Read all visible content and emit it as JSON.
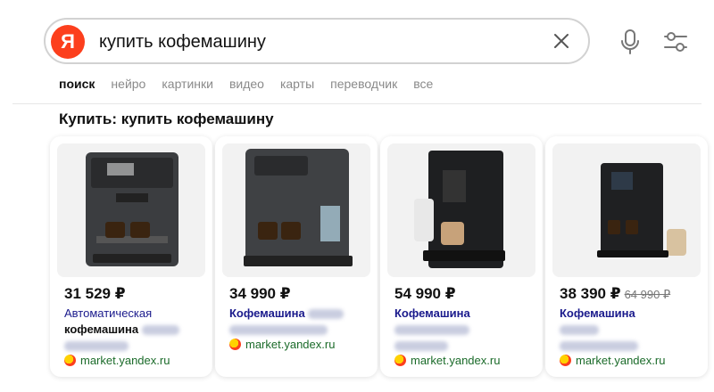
{
  "search": {
    "logo": "Я",
    "query": "купить кофемашину"
  },
  "tabs": [
    {
      "label": "поиск",
      "active": true
    },
    {
      "label": "нейро",
      "active": false
    },
    {
      "label": "картинки",
      "active": false
    },
    {
      "label": "видео",
      "active": false
    },
    {
      "label": "карты",
      "active": false
    },
    {
      "label": "переводчик",
      "active": false
    },
    {
      "label": "все",
      "active": false
    }
  ],
  "section_title": "Купить: купить кофемашину",
  "products": [
    {
      "price": "31 529 ₽",
      "old_price": "",
      "line1": "Автоматическая",
      "line2": "кофемашина",
      "source": "market.yandex.ru"
    },
    {
      "price": "34 990 ₽",
      "old_price": "",
      "line1": "Кофемашина",
      "line2": "",
      "source": "market.yandex.ru"
    },
    {
      "price": "54 990 ₽",
      "old_price": "",
      "line1": "Кофемашина",
      "line2": "",
      "source": "market.yandex.ru"
    },
    {
      "price": "38 390 ₽",
      "old_price": "64 990 ₽",
      "line1": "Кофемашина",
      "line2": "",
      "source": "market.yandex.ru"
    }
  ],
  "colors": {
    "brand": "#fc3f1d",
    "link": "#1a1a8c",
    "source": "#1b6b2a"
  },
  "icons": {
    "logo": "yandex-logo",
    "clear": "close-icon",
    "mic": "microphone-icon",
    "settings": "filters-icon",
    "market": "market-icon"
  }
}
